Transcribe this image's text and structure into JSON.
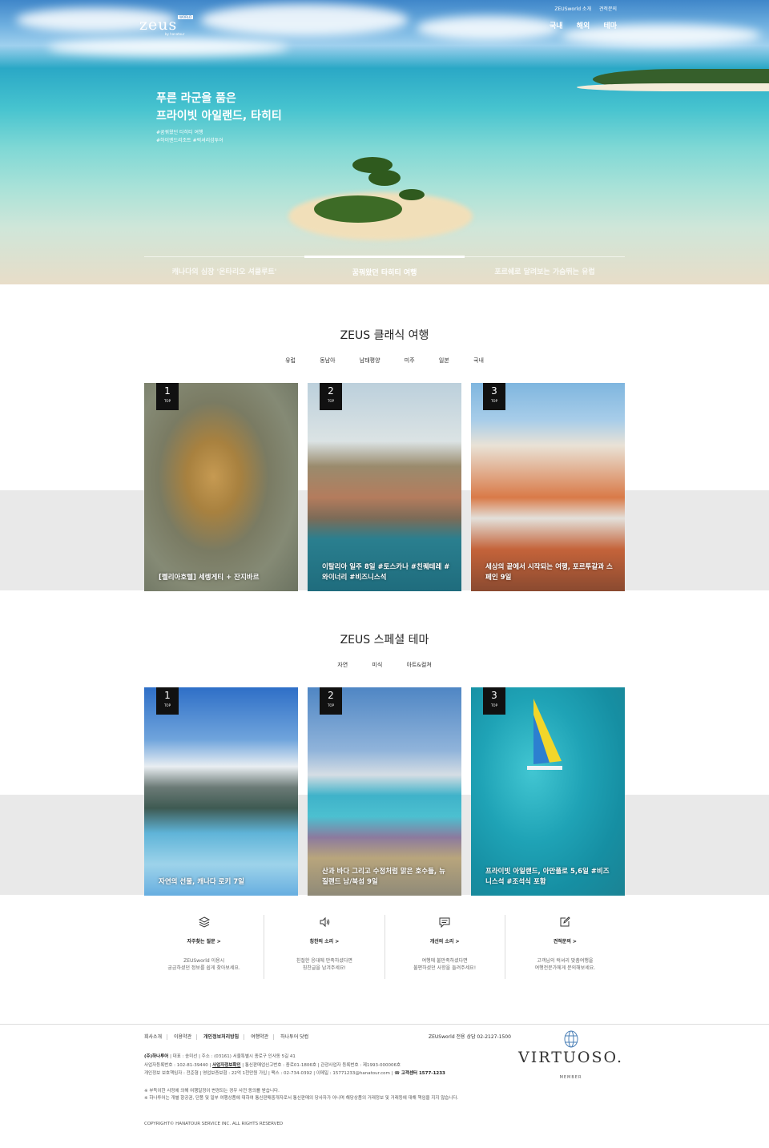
{
  "header": {
    "logo": "zeus",
    "logo_tag": "WORLD",
    "logo_sub": "by hanatour",
    "util": [
      "ZEUSworld 소개",
      "견적문의"
    ],
    "gnb": [
      "국내",
      "해외",
      "테마"
    ]
  },
  "hero": {
    "title1": "푸른 라군을 품은",
    "title2": "프라이빗 아일랜드, 타히티",
    "hash1": "#꿈꿔왔던 타히티 여행",
    "hash2": "#하이엔드리조트 #럭셔리섬투어",
    "tabs": [
      "캐나다의 심장 '온타리오 셔클루트'",
      "꿈꿔왔던 타히티 여행",
      "포르쉐로 달려보는 가슴뛰는 유럽"
    ]
  },
  "classic": {
    "title": "ZEUS 클래식 여행",
    "tabs": [
      "유럽",
      "동남아",
      "남태평양",
      "미주",
      "일본",
      "국내"
    ],
    "cards": [
      {
        "rank": "1",
        "top": "TOP",
        "text": "[펠리아호텔] 세렝게티 + 잔지바르"
      },
      {
        "rank": "2",
        "top": "TOP",
        "text": "이탈리아 일주 8일 #토스카나 #친퀘테레 #와이너리 #비즈니스석"
      },
      {
        "rank": "3",
        "top": "TOP",
        "text": "세상의 끝에서 시작되는 여행, 포르투갈과 스페인 9일"
      }
    ]
  },
  "special": {
    "title": "ZEUS 스페셜 테마",
    "tabs": [
      "자연",
      "미식",
      "아트&컬쳐"
    ],
    "cards": [
      {
        "rank": "1",
        "top": "TOP",
        "text": "자연의 선물, 캐나다 로키 7일"
      },
      {
        "rank": "2",
        "top": "TOP",
        "text": "산과 바다 그리고 수정처럼 맑은 호수들, 뉴질랜드 남/북섬 9일"
      },
      {
        "rank": "3",
        "top": "TOP",
        "text": "프라이빗 아일랜드, 아만풀로 5,6일 #비즈니스석 #조석식 포함"
      }
    ]
  },
  "help": [
    {
      "icon": "layers-icon",
      "label": "자주찾는 질문 >",
      "desc": "ZEUSworld 이용시\n궁금하셨던 정보를 쉽게 찾아보세요."
    },
    {
      "icon": "speaker-icon",
      "label": "칭찬의 소리 >",
      "desc": "친절한 응대에 만족하셨다면\n칭찬글을 남겨주세요!"
    },
    {
      "icon": "chat-icon",
      "label": "개선의 소리 >",
      "desc": "여행에 불만족하셨다면\n불편하셨던 사항을 들려주세요!"
    },
    {
      "icon": "edit-icon",
      "label": "견적문의 >",
      "desc": "고객님의 럭셔리 맞춤여행을\n여행전문가에게 문의해보세요."
    }
  ],
  "footer": {
    "links": [
      "회사소개",
      "이용약관",
      "개인정보처리방침",
      "여행약관",
      "하나투어 닷컴"
    ],
    "phone": "ZEUSworld 전용 상담 02-2127-1500",
    "company": "(주)하나투어",
    "line1": " | 대표 : 송미선 | 주소 : (03161) 서울특별시 종로구 인사동 5길 41",
    "line2a": "사업자등록번호 : 102-81-39440 | ",
    "line2b": "사업자정보확인",
    "line2c": " | 통신판매업신고번호 : 종로01-1806호 | 관광사업자 등록번호 : 제1993-000006호",
    "line3a": "개인정보 보호책임자 : 전준형 | 영업보증보험 : 22억 1천만원 가입 | 팩스 : 02-734-0392 | 이메일 : 15771233@hanatour.com | ",
    "line3b": "고객센터 1577-1233",
    "note1": "※ 부득이한 사정에 의해 여행일정이 변경되는 경우 사전 동의를 받습니다.",
    "note2": "※ 하나투어는 개별 항공권, 단품 및 일부 여행상품에 대하여 통신판매중개자로서 통신판매의 당사자가 아니며 해당상품의 거래정보 및 거래등에 대해 책임을 지지 않습니다.",
    "copyright": "COPYRIGHT© HANATOUR SERVICE INC. ALL RIGHTS RESERVED",
    "virtuoso": "VIRTUOSO.",
    "member": "MEMBER"
  }
}
